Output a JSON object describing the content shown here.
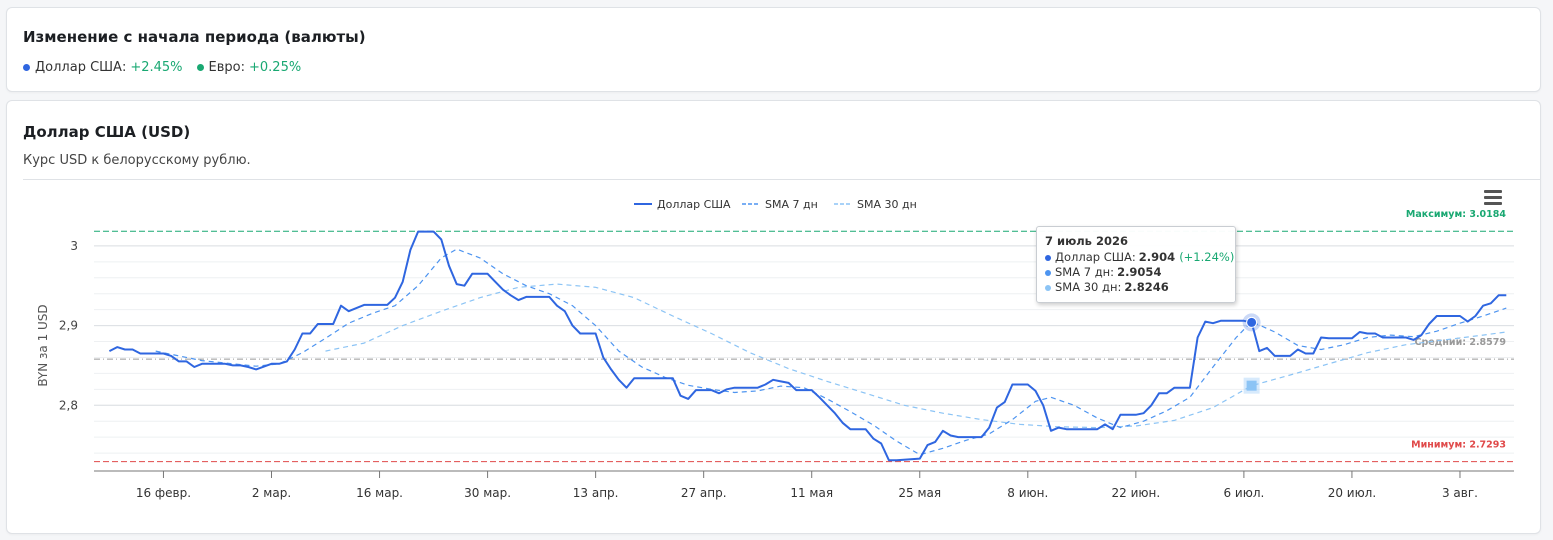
{
  "summary": {
    "title": "Изменение с начала периода (валюты)",
    "items": [
      {
        "label": "Доллар США:",
        "change": "+2.45%",
        "color": "#2f66e0"
      },
      {
        "label": "Евро:",
        "change": "+0.25%",
        "color": "#19a872"
      }
    ]
  },
  "usd_card": {
    "title": "Доллар США (USD)",
    "subtitle": "Курс USD к белорусскому рублю."
  },
  "tooltip": {
    "date": "7 июль 2026",
    "rows": [
      {
        "label": "Доллар США:",
        "value": "2.904",
        "change": "(+1.24%)",
        "color": "#2f66e0"
      },
      {
        "label": "SMA 7 дн:",
        "value": "2.9054",
        "change": "",
        "color": "#4d94f0"
      },
      {
        "label": "SMA 30 дн:",
        "value": "2.8246",
        "change": "",
        "color": "#8cc4f5"
      }
    ]
  },
  "chart_data": {
    "type": "line",
    "ylabel": "BYN за 1 USD",
    "ylim": [
      2.72,
      3.03
    ],
    "y_ticks": [
      2.8,
      2.9,
      3.0
    ],
    "y_tick_labels": [
      "2,8",
      "2,9",
      "3"
    ],
    "x_range": [
      "2026-02-07",
      "2026-08-10"
    ],
    "x_ticks": [
      {
        "date": "2026-02-16",
        "label": "16 февр."
      },
      {
        "date": "2026-03-02",
        "label": "2 мар."
      },
      {
        "date": "2026-03-16",
        "label": "16 мар."
      },
      {
        "date": "2026-03-30",
        "label": "30 мар."
      },
      {
        "date": "2026-04-13",
        "label": "13 апр."
      },
      {
        "date": "2026-04-27",
        "label": "27 апр."
      },
      {
        "date": "2026-05-11",
        "label": "11 мая"
      },
      {
        "date": "2026-05-25",
        "label": "25 мая"
      },
      {
        "date": "2026-06-08",
        "label": "8 июн."
      },
      {
        "date": "2026-06-22",
        "label": "22 июн."
      },
      {
        "date": "2026-07-06",
        "label": "6 июл."
      },
      {
        "date": "2026-07-20",
        "label": "20 июл."
      },
      {
        "date": "2026-08-03",
        "label": "3 авг."
      }
    ],
    "plot_lines": [
      {
        "label": "Максимум: 3.0184",
        "value": 3.0184,
        "color": "#19a872"
      },
      {
        "label": "Средний: 2.8579",
        "value": 2.8579,
        "color": "#999999"
      },
      {
        "label": "Минимум: 2.7293",
        "value": 2.7293,
        "color": "#e04a4a"
      }
    ],
    "series": [
      {
        "name": "Доллар США",
        "color": "#2f66e0",
        "dash": "none",
        "points": [
          [
            "2026-02-09",
            2.868
          ],
          [
            "2026-02-10",
            2.873
          ],
          [
            "2026-02-11",
            2.87
          ],
          [
            "2026-02-12",
            2.87
          ],
          [
            "2026-02-13",
            2.865
          ],
          [
            "2026-02-16",
            2.865
          ],
          [
            "2026-02-17",
            2.862
          ],
          [
            "2026-02-18",
            2.855
          ],
          [
            "2026-02-19",
            2.855
          ],
          [
            "2026-02-20",
            2.848
          ],
          [
            "2026-02-21",
            2.852
          ],
          [
            "2026-02-24",
            2.852
          ],
          [
            "2026-02-25",
            2.85
          ],
          [
            "2026-02-26",
            2.85
          ],
          [
            "2026-02-27",
            2.848
          ],
          [
            "2026-02-28",
            2.845
          ],
          [
            "2026-03-02",
            2.852
          ],
          [
            "2026-03-03",
            2.852
          ],
          [
            "2026-03-04",
            2.855
          ],
          [
            "2026-03-05",
            2.87
          ],
          [
            "2026-03-06",
            2.89
          ],
          [
            "2026-03-07",
            2.89
          ],
          [
            "2026-03-08",
            2.902
          ],
          [
            "2026-03-10",
            2.902
          ],
          [
            "2026-03-11",
            2.925
          ],
          [
            "2026-03-12",
            2.918
          ],
          [
            "2026-03-13",
            2.922
          ],
          [
            "2026-03-14",
            2.926
          ],
          [
            "2026-03-17",
            2.926
          ],
          [
            "2026-03-18",
            2.935
          ],
          [
            "2026-03-19",
            2.955
          ],
          [
            "2026-03-20",
            2.995
          ],
          [
            "2026-03-21",
            3.018
          ],
          [
            "2026-03-23",
            3.018
          ],
          [
            "2026-03-24",
            3.008
          ],
          [
            "2026-03-25",
            2.975
          ],
          [
            "2026-03-26",
            2.952
          ],
          [
            "2026-03-27",
            2.95
          ],
          [
            "2026-03-28",
            2.965
          ],
          [
            "2026-03-30",
            2.965
          ],
          [
            "2026-03-31",
            2.955
          ],
          [
            "2026-04-01",
            2.945
          ],
          [
            "2026-04-02",
            2.938
          ],
          [
            "2026-04-03",
            2.932
          ],
          [
            "2026-04-04",
            2.936
          ],
          [
            "2026-04-07",
            2.936
          ],
          [
            "2026-04-08",
            2.925
          ],
          [
            "2026-04-09",
            2.918
          ],
          [
            "2026-04-10",
            2.9
          ],
          [
            "2026-04-11",
            2.89
          ],
          [
            "2026-04-13",
            2.89
          ],
          [
            "2026-04-14",
            2.86
          ],
          [
            "2026-04-15",
            2.845
          ],
          [
            "2026-04-16",
            2.832
          ],
          [
            "2026-04-17",
            2.822
          ],
          [
            "2026-04-18",
            2.834
          ],
          [
            "2026-04-21",
            2.834
          ],
          [
            "2026-04-22",
            2.834
          ],
          [
            "2026-04-23",
            2.834
          ],
          [
            "2026-04-24",
            2.812
          ],
          [
            "2026-04-25",
            2.808
          ],
          [
            "2026-04-26",
            2.819
          ],
          [
            "2026-04-28",
            2.819
          ],
          [
            "2026-04-29",
            2.815
          ],
          [
            "2026-04-30",
            2.82
          ],
          [
            "2026-05-01",
            2.822
          ],
          [
            "2026-05-04",
            2.822
          ],
          [
            "2026-05-05",
            2.826
          ],
          [
            "2026-05-06",
            2.832
          ],
          [
            "2026-05-07",
            2.83
          ],
          [
            "2026-05-08",
            2.828
          ],
          [
            "2026-05-09",
            2.819
          ],
          [
            "2026-05-11",
            2.819
          ],
          [
            "2026-05-12",
            2.81
          ],
          [
            "2026-05-13",
            2.8
          ],
          [
            "2026-05-14",
            2.79
          ],
          [
            "2026-05-15",
            2.778
          ],
          [
            "2026-05-16",
            2.77
          ],
          [
            "2026-05-18",
            2.77
          ],
          [
            "2026-05-19",
            2.758
          ],
          [
            "2026-05-20",
            2.752
          ],
          [
            "2026-05-21",
            2.731
          ],
          [
            "2026-05-22",
            2.731
          ],
          [
            "2026-05-25",
            2.733
          ],
          [
            "2026-05-26",
            2.75
          ],
          [
            "2026-05-27",
            2.754
          ],
          [
            "2026-05-28",
            2.768
          ],
          [
            "2026-05-29",
            2.762
          ],
          [
            "2026-05-30",
            2.76
          ],
          [
            "2026-06-02",
            2.76
          ],
          [
            "2026-06-03",
            2.772
          ],
          [
            "2026-06-04",
            2.797
          ],
          [
            "2026-06-05",
            2.804
          ],
          [
            "2026-06-06",
            2.826
          ],
          [
            "2026-06-08",
            2.826
          ],
          [
            "2026-06-09",
            2.818
          ],
          [
            "2026-06-10",
            2.8
          ],
          [
            "2026-06-11",
            2.768
          ],
          [
            "2026-06-12",
            2.772
          ],
          [
            "2026-06-13",
            2.77
          ],
          [
            "2026-06-17",
            2.77
          ],
          [
            "2026-06-18",
            2.776
          ],
          [
            "2026-06-19",
            2.77
          ],
          [
            "2026-06-20",
            2.788
          ],
          [
            "2026-06-22",
            2.788
          ],
          [
            "2026-06-23",
            2.79
          ],
          [
            "2026-06-24",
            2.8
          ],
          [
            "2026-06-25",
            2.815
          ],
          [
            "2026-06-26",
            2.815
          ],
          [
            "2026-06-27",
            2.822
          ],
          [
            "2026-06-29",
            2.822
          ],
          [
            "2026-06-30",
            2.885
          ],
          [
            "2026-07-01",
            2.905
          ],
          [
            "2026-07-02",
            2.903
          ],
          [
            "2026-07-03",
            2.906
          ],
          [
            "2026-07-06",
            2.906
          ],
          [
            "2026-07-07",
            2.904
          ],
          [
            "2026-07-08",
            2.868
          ],
          [
            "2026-07-09",
            2.872
          ],
          [
            "2026-07-10",
            2.862
          ],
          [
            "2026-07-12",
            2.862
          ],
          [
            "2026-07-13",
            2.87
          ],
          [
            "2026-07-14",
            2.865
          ],
          [
            "2026-07-15",
            2.865
          ],
          [
            "2026-07-16",
            2.885
          ],
          [
            "2026-07-17",
            2.884
          ],
          [
            "2026-07-20",
            2.884
          ],
          [
            "2026-07-21",
            2.892
          ],
          [
            "2026-07-22",
            2.89
          ],
          [
            "2026-07-23",
            2.89
          ],
          [
            "2026-07-24",
            2.885
          ],
          [
            "2026-07-27",
            2.885
          ],
          [
            "2026-07-28",
            2.882
          ],
          [
            "2026-07-29",
            2.888
          ],
          [
            "2026-07-30",
            2.902
          ],
          [
            "2026-07-31",
            2.912
          ],
          [
            "2026-08-03",
            2.912
          ],
          [
            "2026-08-04",
            2.905
          ],
          [
            "2026-08-05",
            2.912
          ],
          [
            "2026-08-06",
            2.925
          ],
          [
            "2026-08-07",
            2.928
          ],
          [
            "2026-08-08",
            2.938
          ],
          [
            "2026-08-09",
            2.938
          ]
        ]
      },
      {
        "name": "SMA 7 дн",
        "color": "#4d94f0",
        "dash": "5,4",
        "points": [
          [
            "2026-02-15",
            2.868
          ],
          [
            "2026-02-18",
            2.862
          ],
          [
            "2026-02-21",
            2.856
          ],
          [
            "2026-02-25",
            2.852
          ],
          [
            "2026-02-28",
            2.849
          ],
          [
            "2026-03-03",
            2.852
          ],
          [
            "2026-03-06",
            2.866
          ],
          [
            "2026-03-09",
            2.884
          ],
          [
            "2026-03-12",
            2.903
          ],
          [
            "2026-03-15",
            2.915
          ],
          [
            "2026-03-18",
            2.925
          ],
          [
            "2026-03-21",
            2.95
          ],
          [
            "2026-03-24",
            2.985
          ],
          [
            "2026-03-26",
            2.996
          ],
          [
            "2026-03-29",
            2.985
          ],
          [
            "2026-04-01",
            2.965
          ],
          [
            "2026-04-04",
            2.95
          ],
          [
            "2026-04-07",
            2.94
          ],
          [
            "2026-04-10",
            2.925
          ],
          [
            "2026-04-13",
            2.9
          ],
          [
            "2026-04-16",
            2.868
          ],
          [
            "2026-04-19",
            2.848
          ],
          [
            "2026-04-22",
            2.835
          ],
          [
            "2026-04-25",
            2.825
          ],
          [
            "2026-04-28",
            2.82
          ],
          [
            "2026-05-01",
            2.816
          ],
          [
            "2026-05-04",
            2.818
          ],
          [
            "2026-05-07",
            2.824
          ],
          [
            "2026-05-10",
            2.822
          ],
          [
            "2026-05-13",
            2.808
          ],
          [
            "2026-05-16",
            2.792
          ],
          [
            "2026-05-19",
            2.775
          ],
          [
            "2026-05-22",
            2.755
          ],
          [
            "2026-05-25",
            2.738
          ],
          [
            "2026-05-28",
            2.746
          ],
          [
            "2026-05-31",
            2.756
          ],
          [
            "2026-06-03",
            2.764
          ],
          [
            "2026-06-06",
            2.782
          ],
          [
            "2026-06-09",
            2.805
          ],
          [
            "2026-06-11",
            2.81
          ],
          [
            "2026-06-14",
            2.8
          ],
          [
            "2026-06-17",
            2.784
          ],
          [
            "2026-06-20",
            2.772
          ],
          [
            "2026-06-23",
            2.78
          ],
          [
            "2026-06-26",
            2.793
          ],
          [
            "2026-06-29",
            2.81
          ],
          [
            "2026-07-02",
            2.848
          ],
          [
            "2026-07-05",
            2.885
          ],
          [
            "2026-07-07",
            2.905
          ],
          [
            "2026-07-10",
            2.892
          ],
          [
            "2026-07-13",
            2.875
          ],
          [
            "2026-07-16",
            2.87
          ],
          [
            "2026-07-19",
            2.876
          ],
          [
            "2026-07-22",
            2.885
          ],
          [
            "2026-07-25",
            2.888
          ],
          [
            "2026-07-28",
            2.886
          ],
          [
            "2026-07-31",
            2.893
          ],
          [
            "2026-08-03",
            2.903
          ],
          [
            "2026-08-06",
            2.912
          ],
          [
            "2026-08-09",
            2.922
          ]
        ]
      },
      {
        "name": "SMA 30 дн",
        "color": "#8cc4f5",
        "dash": "5,4",
        "points": [
          [
            "2026-03-09",
            2.868
          ],
          [
            "2026-03-14",
            2.878
          ],
          [
            "2026-03-19",
            2.9
          ],
          [
            "2026-03-24",
            2.918
          ],
          [
            "2026-03-29",
            2.935
          ],
          [
            "2026-04-03",
            2.948
          ],
          [
            "2026-04-08",
            2.952
          ],
          [
            "2026-04-13",
            2.948
          ],
          [
            "2026-04-18",
            2.935
          ],
          [
            "2026-04-23",
            2.912
          ],
          [
            "2026-04-28",
            2.89
          ],
          [
            "2026-05-03",
            2.866
          ],
          [
            "2026-05-08",
            2.846
          ],
          [
            "2026-05-13",
            2.83
          ],
          [
            "2026-05-18",
            2.815
          ],
          [
            "2026-05-23",
            2.8
          ],
          [
            "2026-05-28",
            2.79
          ],
          [
            "2026-06-02",
            2.782
          ],
          [
            "2026-06-07",
            2.776
          ],
          [
            "2026-06-12",
            2.773
          ],
          [
            "2026-06-17",
            2.772
          ],
          [
            "2026-06-22",
            2.774
          ],
          [
            "2026-06-27",
            2.781
          ],
          [
            "2026-07-02",
            2.797
          ],
          [
            "2026-07-07",
            2.8246
          ],
          [
            "2026-07-12",
            2.838
          ],
          [
            "2026-07-17",
            2.852
          ],
          [
            "2026-07-22",
            2.866
          ],
          [
            "2026-07-27",
            2.876
          ],
          [
            "2026-08-01",
            2.882
          ],
          [
            "2026-08-06",
            2.888
          ],
          [
            "2026-08-09",
            2.892
          ]
        ]
      }
    ],
    "highlight_date": "2026-07-07"
  }
}
